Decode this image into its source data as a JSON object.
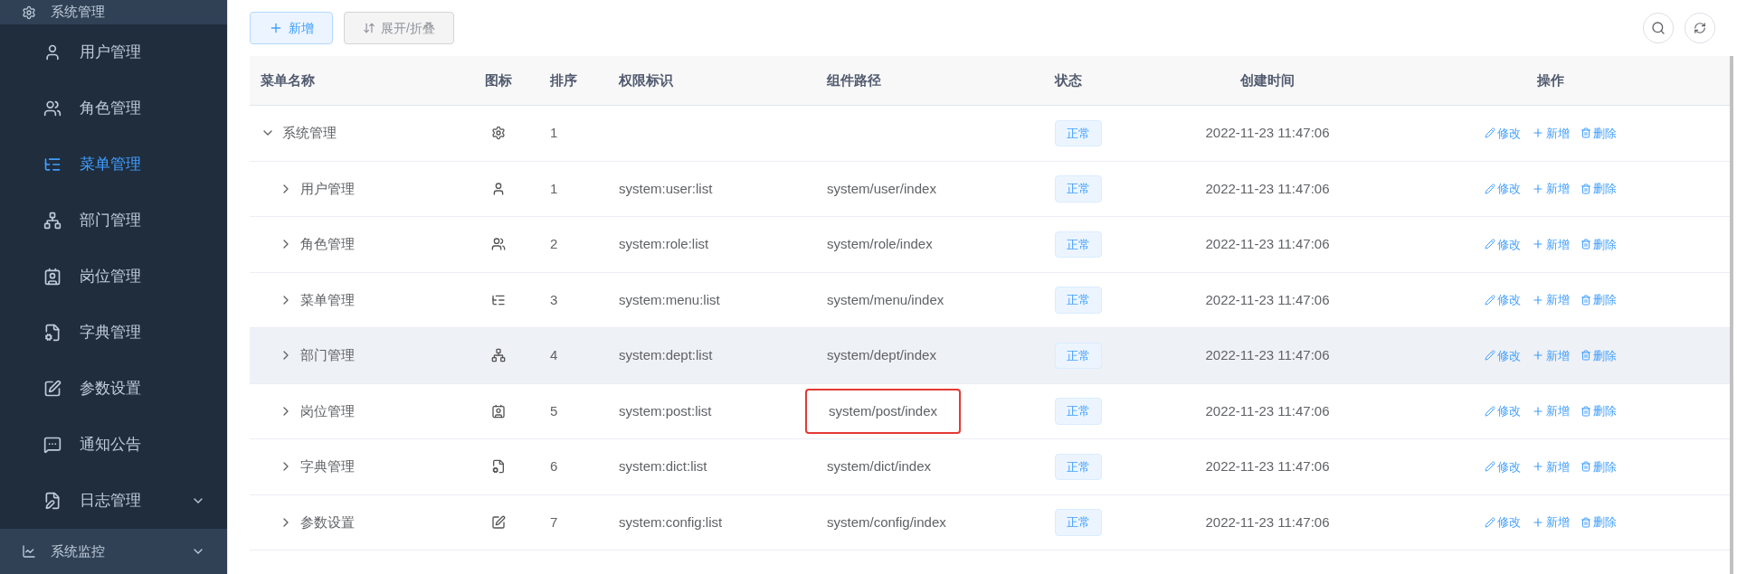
{
  "sidebar": {
    "top_group": {
      "label": "系统管理",
      "kind": "gear"
    },
    "items": [
      {
        "label": "用户管理",
        "kind": "user",
        "selected": false,
        "expandable": false
      },
      {
        "label": "角色管理",
        "kind": "users",
        "selected": false,
        "expandable": false
      },
      {
        "label": "菜单管理",
        "kind": "tree-list",
        "selected": true,
        "expandable": false
      },
      {
        "label": "部门管理",
        "kind": "sitemap",
        "selected": false,
        "expandable": false
      },
      {
        "label": "岗位管理",
        "kind": "badge",
        "selected": false,
        "expandable": false
      },
      {
        "label": "字典管理",
        "kind": "dict",
        "selected": false,
        "expandable": false
      },
      {
        "label": "参数设置",
        "kind": "edit",
        "selected": false,
        "expandable": false
      },
      {
        "label": "通知公告",
        "kind": "message",
        "selected": false,
        "expandable": false
      },
      {
        "label": "日志管理",
        "kind": "log",
        "selected": false,
        "expandable": true
      }
    ],
    "bottom_group": {
      "label": "系统监控",
      "kind": "monitor"
    }
  },
  "toolbar": {
    "add_button": "新增",
    "toggle_button": "展开/折叠"
  },
  "table": {
    "columns": [
      "菜单名称",
      "图标",
      "排序",
      "权限标识",
      "组件路径",
      "状态",
      "创建时间",
      "操作"
    ],
    "rows": [
      {
        "name": "系统管理",
        "kind": "gear",
        "order": "1",
        "perms": "",
        "path": "",
        "status": "正常",
        "created": "2022-11-23 11:47:06",
        "expanded": true,
        "hovered": false,
        "highlighted": false,
        "actions": [
          "修改",
          "新增",
          "删除"
        ],
        "children": [
          {
            "name": "用户管理",
            "kind": "user",
            "order": "1",
            "perms": "system:user:list",
            "path": "system/user/index",
            "status": "正常",
            "created": "2022-11-23 11:47:06",
            "expanded": false,
            "hovered": false,
            "highlighted": false,
            "actions": [
              "修改",
              "新增",
              "删除"
            ]
          },
          {
            "name": "角色管理",
            "kind": "users",
            "order": "2",
            "perms": "system:role:list",
            "path": "system/role/index",
            "status": "正常",
            "created": "2022-11-23 11:47:06",
            "expanded": false,
            "hovered": false,
            "highlighted": false,
            "actions": [
              "修改",
              "新增",
              "删除"
            ]
          },
          {
            "name": "菜单管理",
            "kind": "tree-list",
            "order": "3",
            "perms": "system:menu:list",
            "path": "system/menu/index",
            "status": "正常",
            "created": "2022-11-23 11:47:06",
            "expanded": false,
            "hovered": false,
            "highlighted": false,
            "actions": [
              "修改",
              "新增",
              "删除"
            ]
          },
          {
            "name": "部门管理",
            "kind": "sitemap",
            "order": "4",
            "perms": "system:dept:list",
            "path": "system/dept/index",
            "status": "正常",
            "created": "2022-11-23 11:47:06",
            "expanded": false,
            "hovered": true,
            "highlighted": false,
            "actions": [
              "修改",
              "新增",
              "删除"
            ]
          },
          {
            "name": "岗位管理",
            "kind": "badge",
            "order": "5",
            "perms": "system:post:list",
            "path": "system/post/index",
            "status": "正常",
            "created": "2022-11-23 11:47:06",
            "expanded": false,
            "hovered": false,
            "highlighted": true,
            "actions": [
              "修改",
              "新增",
              "删除"
            ]
          },
          {
            "name": "字典管理",
            "kind": "dict",
            "order": "6",
            "perms": "system:dict:list",
            "path": "system/dict/index",
            "status": "正常",
            "created": "2022-11-23 11:47:06",
            "expanded": false,
            "hovered": false,
            "highlighted": false,
            "actions": [
              "修改",
              "新增",
              "删除"
            ]
          },
          {
            "name": "参数设置",
            "kind": "edit",
            "order": "7",
            "perms": "system:config:list",
            "path": "system/config/index",
            "status": "正常",
            "created": "2022-11-23 11:47:06",
            "expanded": false,
            "hovered": false,
            "highlighted": false,
            "actions": [
              "修改",
              "新增",
              "删除"
            ]
          }
        ]
      }
    ]
  }
}
